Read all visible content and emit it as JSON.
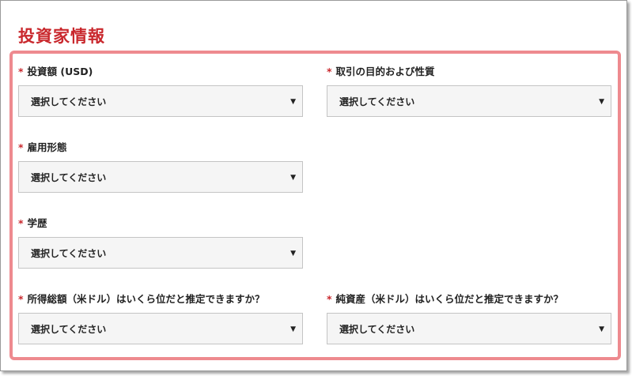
{
  "section": {
    "title": "投資家情報"
  },
  "required_mark": "*",
  "fields": [
    {
      "label": "投資額 (USD)",
      "value": "選択してください"
    },
    {
      "label": "取引の目的および性質",
      "value": "選択してください"
    },
    {
      "label": "雇用形態",
      "value": "選択してください"
    },
    {
      "label": "学歴",
      "value": "選択してください"
    },
    {
      "label": "所得総額（米ドル）はいくら位だと推定できますか？",
      "value": "選択してください"
    },
    {
      "label": "純資産（米ドル）はいくら位だと推定できますか？",
      "value": "選択してください"
    }
  ],
  "icons": {
    "dropdown": "caret-down-icon",
    "caret_glyph": "▼"
  },
  "colors": {
    "accent": "#c9282d",
    "panel_border": "#ee8a8f",
    "select_bg": "#f5f5f5"
  }
}
